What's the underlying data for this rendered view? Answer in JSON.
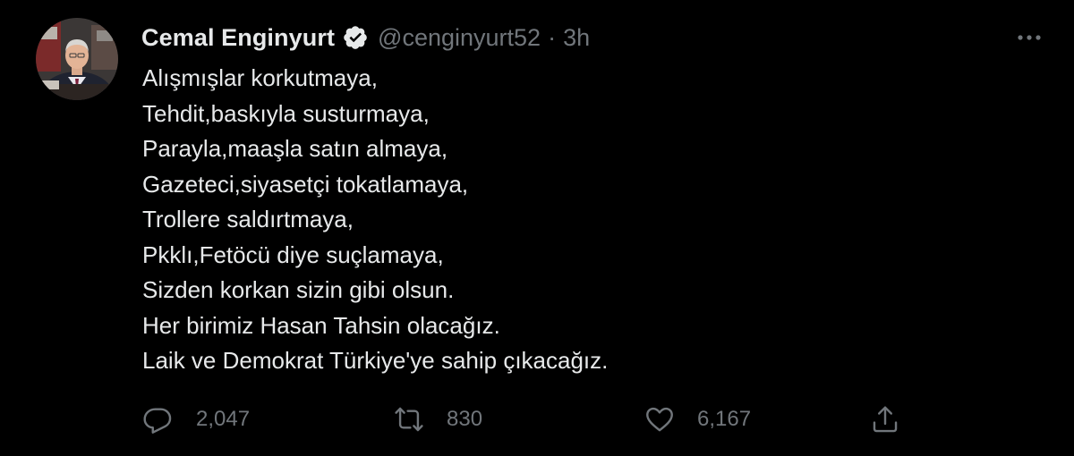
{
  "author": {
    "display_name": "Cemal Enginyurt",
    "handle": "@cenginyurt52",
    "separator": "·",
    "time": "3h",
    "verified": true,
    "avatar_icon": "profile-photo"
  },
  "tweet": {
    "lines": [
      "Alışmışlar korkutmaya,",
      "Tehdit,baskıyla susturmaya,",
      "Parayla,maaşla satın almaya,",
      "Gazeteci,siyasetçi tokatlamaya,",
      "Trollere saldırtmaya,",
      "Pkklı,Fetöcü diye suçlamaya,",
      "Sizden korkan sizin gibi olsun.",
      "Her birimiz Hasan Tahsin olacağız.",
      "Laik ve Demokrat Türkiye'ye sahip çıkacağız."
    ]
  },
  "actions": {
    "reply": {
      "icon": "reply-icon",
      "count": "2,047"
    },
    "retweet": {
      "icon": "retweet-icon",
      "count": "830"
    },
    "like": {
      "icon": "like-icon",
      "count": "6,167"
    },
    "share": {
      "icon": "share-icon"
    }
  },
  "more_icon": "more-icon",
  "colors": {
    "background": "#000000",
    "text": "#e7e9ea",
    "secondary": "#71767b",
    "verified_badge": "#e7e9ea"
  }
}
